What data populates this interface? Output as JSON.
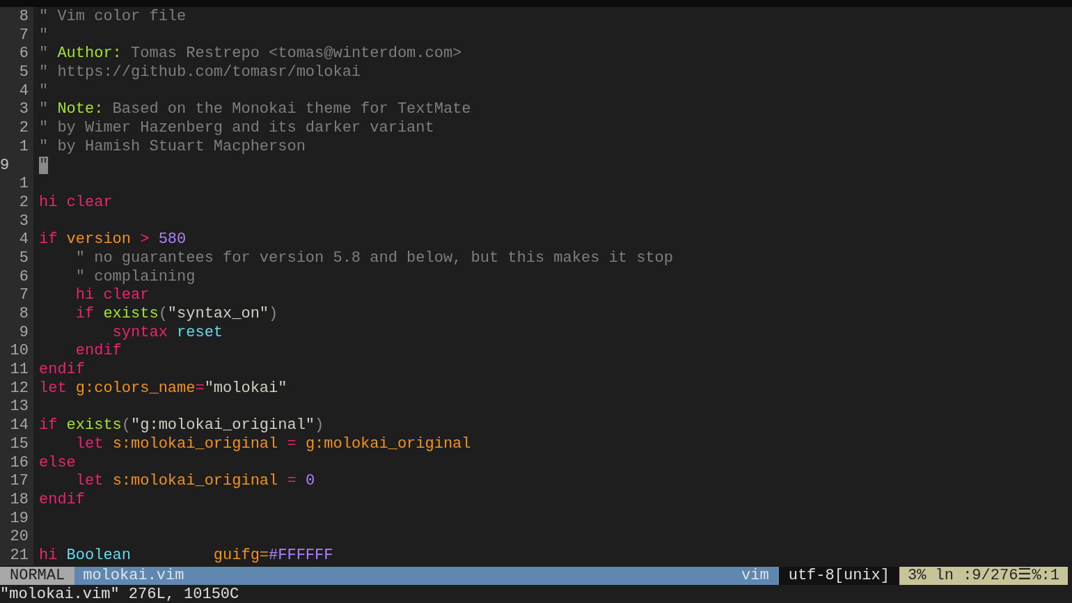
{
  "editor": {
    "lines": [
      {
        "number": "8",
        "current": false,
        "tokens": [
          {
            "kind": "comment",
            "text": "\" Vim color file"
          }
        ]
      },
      {
        "number": "7",
        "current": false,
        "tokens": [
          {
            "kind": "comment",
            "text": "\""
          }
        ]
      },
      {
        "number": "6",
        "current": false,
        "tokens": [
          {
            "kind": "comment",
            "text": "\" "
          },
          {
            "kind": "label",
            "text": "Author:"
          },
          {
            "kind": "comment",
            "text": " Tomas Restrepo <tomas@winterdom.com>"
          }
        ]
      },
      {
        "number": "5",
        "current": false,
        "tokens": [
          {
            "kind": "comment",
            "text": "\" https://github.com/tomasr/molokai"
          }
        ]
      },
      {
        "number": "4",
        "current": false,
        "tokens": [
          {
            "kind": "comment",
            "text": "\""
          }
        ]
      },
      {
        "number": "3",
        "current": false,
        "tokens": [
          {
            "kind": "comment",
            "text": "\" "
          },
          {
            "kind": "label",
            "text": "Note:"
          },
          {
            "kind": "comment",
            "text": " Based on the Monokai theme for TextMate"
          }
        ]
      },
      {
        "number": "2",
        "current": false,
        "tokens": [
          {
            "kind": "comment",
            "text": "\" by Wimer Hazenberg and its darker variant"
          }
        ]
      },
      {
        "number": "1",
        "current": false,
        "tokens": [
          {
            "kind": "comment",
            "text": "\" by Hamish Stuart Macpherson"
          }
        ]
      },
      {
        "number": "9",
        "current": true,
        "tokens": [
          {
            "kind": "cursor",
            "text": "\""
          }
        ]
      },
      {
        "number": "1",
        "current": false
      },
      {
        "number": "2",
        "current": false,
        "tokens": [
          {
            "kind": "keyword",
            "text": "hi clear"
          }
        ]
      },
      {
        "number": "3",
        "current": false
      },
      {
        "number": "4",
        "current": false,
        "tokens": [
          {
            "kind": "keyword",
            "text": "if "
          },
          {
            "kind": "variable",
            "text": "version "
          },
          {
            "kind": "operator",
            "text": "> "
          },
          {
            "kind": "number",
            "text": "580"
          }
        ]
      },
      {
        "number": "5",
        "current": false,
        "tokens": [
          {
            "kind": "comment",
            "text": "    \" no guarantees for version 5.8 and below, but this makes it stop"
          }
        ]
      },
      {
        "number": "6",
        "current": false,
        "tokens": [
          {
            "kind": "comment",
            "text": "    \" complaining"
          }
        ]
      },
      {
        "number": "7",
        "current": false,
        "tokens": [
          {
            "kind": "keyword",
            "text": "    hi clear"
          }
        ]
      },
      {
        "number": "8",
        "current": false,
        "tokens": [
          {
            "kind": "keyword",
            "text": "    if "
          },
          {
            "kind": "function",
            "text": "exists"
          },
          {
            "kind": "punct",
            "text": "("
          },
          {
            "kind": "string",
            "text": "\"syntax_on\""
          },
          {
            "kind": "punct",
            "text": ")"
          }
        ]
      },
      {
        "number": "9",
        "current": false,
        "tokens": [
          {
            "kind": "keyword",
            "text": "        syntax "
          },
          {
            "kind": "identifier",
            "text": "reset"
          }
        ]
      },
      {
        "number": "10",
        "current": false,
        "tokens": [
          {
            "kind": "keyword",
            "text": "    endif"
          }
        ]
      },
      {
        "number": "11",
        "current": false,
        "tokens": [
          {
            "kind": "keyword",
            "text": "endif"
          }
        ]
      },
      {
        "number": "12",
        "current": false,
        "tokens": [
          {
            "kind": "keyword",
            "text": "let "
          },
          {
            "kind": "variable",
            "text": "g:colors_name"
          },
          {
            "kind": "operator",
            "text": "="
          },
          {
            "kind": "string",
            "text": "\"molokai\""
          }
        ]
      },
      {
        "number": "13",
        "current": false
      },
      {
        "number": "14",
        "current": false,
        "tokens": [
          {
            "kind": "keyword",
            "text": "if "
          },
          {
            "kind": "function",
            "text": "exists"
          },
          {
            "kind": "punct",
            "text": "("
          },
          {
            "kind": "string",
            "text": "\"g:molokai_original\""
          },
          {
            "kind": "punct",
            "text": ")"
          }
        ]
      },
      {
        "number": "15",
        "current": false,
        "tokens": [
          {
            "kind": "keyword",
            "text": "    let "
          },
          {
            "kind": "variable",
            "text": "s:molokai_original "
          },
          {
            "kind": "operator",
            "text": "= "
          },
          {
            "kind": "variable",
            "text": "g:molokai_original"
          }
        ]
      },
      {
        "number": "16",
        "current": false,
        "tokens": [
          {
            "kind": "keyword",
            "text": "else"
          }
        ]
      },
      {
        "number": "17",
        "current": false,
        "tokens": [
          {
            "kind": "keyword",
            "text": "    let "
          },
          {
            "kind": "variable",
            "text": "s:molokai_original "
          },
          {
            "kind": "operator",
            "text": "= "
          },
          {
            "kind": "number",
            "text": "0"
          }
        ]
      },
      {
        "number": "18",
        "current": false,
        "tokens": [
          {
            "kind": "keyword",
            "text": "endif"
          }
        ]
      },
      {
        "number": "19",
        "current": false
      },
      {
        "number": "20",
        "current": false
      },
      {
        "number": "21",
        "current": false,
        "tokens": [
          {
            "kind": "keyword",
            "text": "hi "
          },
          {
            "kind": "identifier",
            "text": "Boolean         "
          },
          {
            "kind": "variable",
            "text": "guifg="
          },
          {
            "kind": "number",
            "text": "#FFFFFF"
          }
        ]
      }
    ]
  },
  "status_line": {
    "mode": "NORMAL",
    "file_name": "molokai.vim",
    "file_type": "vim",
    "encoding": "utf-8[unix]",
    "position": "3% ln :9/276☰%:1"
  },
  "command_line": {
    "message": "\"molokai.vim\" 276L, 10150C"
  }
}
